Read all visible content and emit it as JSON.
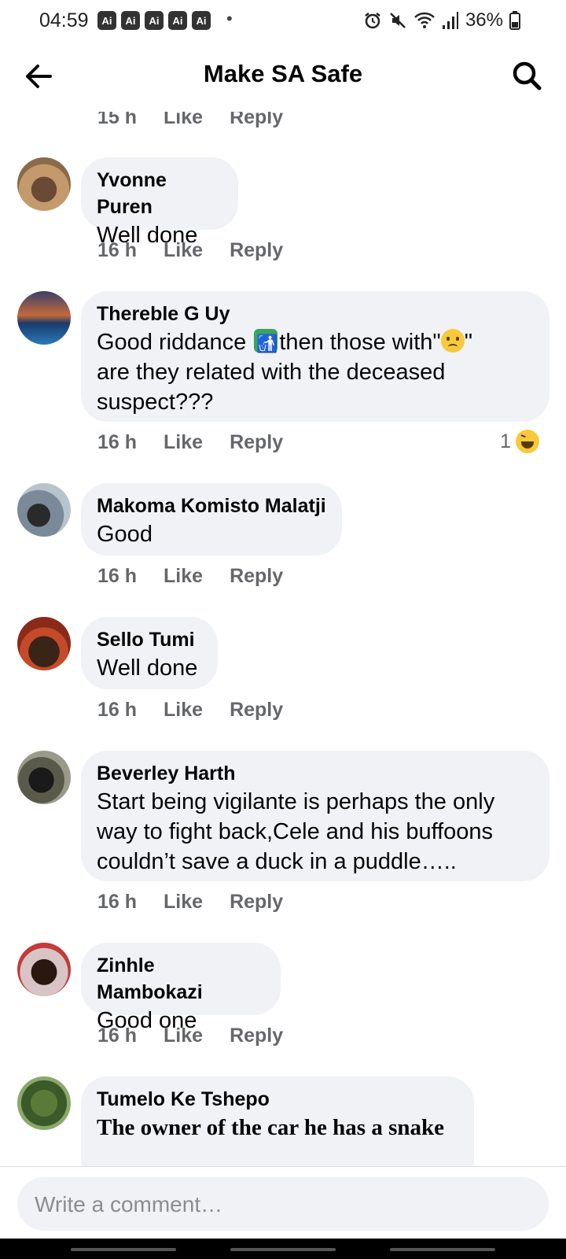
{
  "status_bar": {
    "time": "04:59",
    "notification_badges": [
      "Ai",
      "Ai",
      "Ai",
      "Ai",
      "Ai"
    ],
    "dot": "•",
    "battery": "36%"
  },
  "header": {
    "title": "Make SA Safe",
    "back_icon": "arrow-left-icon",
    "search_icon": "search-icon"
  },
  "top_meta": {
    "time": "15 h",
    "like": "Like",
    "reply": "Reply"
  },
  "comments": [
    {
      "author": "Yvonne Puren",
      "text": "Well done",
      "time": "16 h",
      "like": "Like",
      "reply": "Reply"
    },
    {
      "author": "Thereble G Uy",
      "text_part1": "Good riddance ",
      "text_part2": "then those with\"",
      "text_part3": "\"",
      "text_rest": "are they related with the deceased suspect???",
      "time": "16 h",
      "like": "Like",
      "reply": "Reply",
      "reaction_count": "1"
    },
    {
      "author": "Makoma Komisto Malatji",
      "text": "Good",
      "time": "16 h",
      "like": "Like",
      "reply": "Reply"
    },
    {
      "author": "Sello Tumi",
      "text": "Well done",
      "time": "16 h",
      "like": "Like",
      "reply": "Reply"
    },
    {
      "author": "Beverley Harth",
      "text": "Start being vigilante is perhaps the only way to fight back,Cele and his buffoons couldn’t save a duck in a puddle…..",
      "time": "16 h",
      "like": "Like",
      "reply": "Reply"
    },
    {
      "author": "Zinhle Mambokazi",
      "text": "Good one",
      "time": "16 h",
      "like": "Like",
      "reply": "Reply"
    },
    {
      "author": "Tumelo Ke Tshepo",
      "text": "The owner of the car he has a snake"
    }
  ],
  "composer": {
    "placeholder": "Write a comment…"
  }
}
